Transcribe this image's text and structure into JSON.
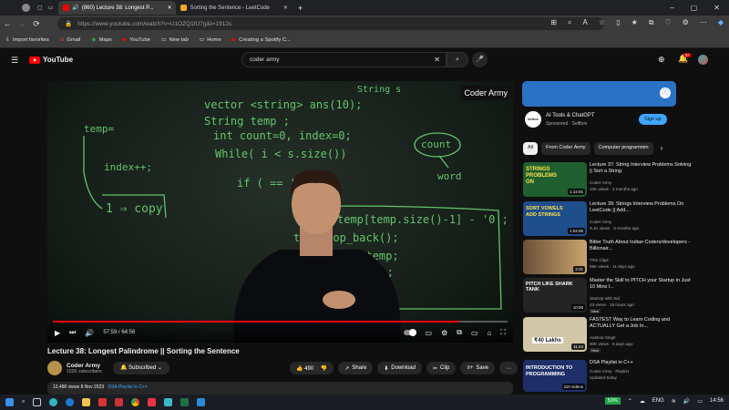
{
  "browser": {
    "tabs": [
      {
        "label": "(860) Lecture 38: Longest P..."
      },
      {
        "label": "Sorting the Sentence - LeetCode"
      }
    ],
    "url": "https://www.youtube.com/watch?v=U1OZQ1fU7g&t=1912s",
    "bookmarks": [
      "Import favorites",
      "Gmail",
      "Maps",
      "YouTube",
      "New tab",
      "Home",
      "Creating a Spotify C..."
    ]
  },
  "youtube": {
    "logo_text": "YouTube",
    "search_value": "coder army",
    "notif_count": "9+"
  },
  "video": {
    "watermark": "Coder Army",
    "time": "57:59 / 64:56",
    "progress": 0.893
  },
  "meta": {
    "title": "Lecture 38: Longest Palindrome || Sorting the Sentence",
    "channel": "Coder Army",
    "subscribers": "102K subscribers",
    "subscribed_label": "Subscribed",
    "likes": "490",
    "share": "Share",
    "download": "Download",
    "clip": "Clip",
    "save": "Save",
    "views_date": "12,490 views  8 Nov 2023",
    "playlist_link": "DSA Playlist in C++"
  },
  "ad": {
    "title": "AI Tools & ChatGPT",
    "sponsor": "Sponsored · Selfbox",
    "signup": "Sign up",
    "logo_text": "bebox"
  },
  "chips": [
    "All",
    "From Coder Army",
    "Computer programmin"
  ],
  "recommendations": [
    {
      "title": "Lecture 37: String Interview Problems Solving || Sort a String",
      "channel": "Coder Army",
      "meta": "13K views · 3 months ago",
      "duration": "1:14:01",
      "thumb_text": "STRINGS PROBLEMS ON",
      "thumb_color": "#1f5f2f"
    },
    {
      "title": "Lecture 39: Strings Interview Problems On LeetCode || Add...",
      "channel": "Coder Army",
      "meta": "9.1K views · 3 months ago",
      "duration": "1:04:05",
      "thumb_text": "SORT VOWELS ADD STRINGS",
      "thumb_color": "#1e4e8c"
    },
    {
      "title": "Bitter Truth About Indian Coders/developers - Billionair...",
      "channel": "TRS Clips",
      "meta": "59K views · 11 days ago",
      "duration": "2:21",
      "thumb_text": "",
      "thumb_color": "#5a4a3a"
    },
    {
      "title": "Master the Skill to PITCH your Startup in Just 10 Mins I...",
      "channel": "StartUp with Sid",
      "meta": "43 views · 19 hours ago",
      "duration": "10:06",
      "badge": "New",
      "thumb_text": "PITCH LIKE SHARK TANK",
      "thumb_color": "#242424"
    },
    {
      "title": "FASTEST Way to Learn Coding and ACTUALLY Get a Job In...",
      "channel": "Aashrai Singh",
      "meta": "90K views · 6 days ago",
      "duration": "11:24",
      "badge": "New",
      "thumb_text": "₹40 Lakhs",
      "thumb_color": "#d2c6a8"
    },
    {
      "title": "DSA Playlist in C++",
      "channel": "Coder Army · Playlist",
      "meta": "Updated today",
      "duration": "110 videos",
      "thumb_text": "INTRODUCTION TO PROGRAMMING",
      "thumb_color": "#1f2f6a"
    }
  ],
  "taskbar": {
    "battery": "53%",
    "lang": "ENG",
    "time": "14:56"
  }
}
